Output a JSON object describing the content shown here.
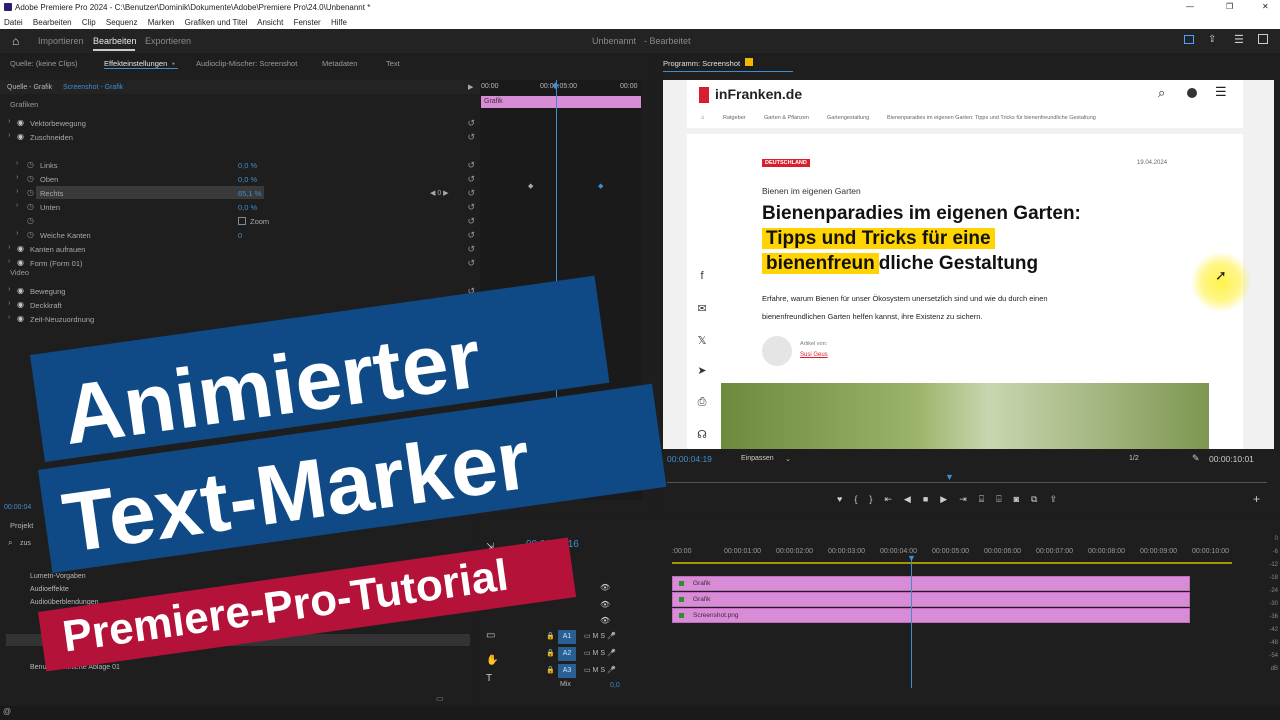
{
  "window": {
    "title": "Adobe Premiere Pro 2024 - C:\\Benutzer\\Dominik\\Dokumente\\Adobe\\Premiere Pro\\24.0\\Unbenannt *",
    "min": "—",
    "restore": "❐",
    "close": "✕"
  },
  "menu": [
    "Datei",
    "Bearbeiten",
    "Clip",
    "Sequenz",
    "Marken",
    "Grafiken und Titel",
    "Ansicht",
    "Fenster",
    "Hilfe"
  ],
  "workspace": {
    "tabs": [
      "Importieren",
      "Bearbeiten",
      "Exportieren"
    ],
    "project": "Unbenannt",
    "project_status": "- Bearbeitet"
  },
  "effects_panel": {
    "tabs": [
      "Quelle: (keine Clips)",
      "Effekteinstellungen",
      "Audioclip-Mischer: Screenshot",
      "Metadaten",
      "Text"
    ],
    "source": "Quelle - Grafik",
    "sequence": "Screenshot - Grafik",
    "sections": {
      "grafiken": "Grafiken",
      "video": "Video"
    },
    "rows": [
      {
        "label": "Vektorbewegung"
      },
      {
        "label": "Zuschneiden"
      },
      {
        "label": "Links",
        "value": "0,0 %"
      },
      {
        "label": "Oben",
        "value": "0,0 %"
      },
      {
        "label": "Rechts",
        "value": "65,1 %",
        "kf": "0"
      },
      {
        "label": "Unten",
        "value": "0,0 %"
      },
      {
        "label": "Zoom"
      },
      {
        "label": "Weiche Kanten",
        "value": "0"
      },
      {
        "label": "Kanten aufrauen"
      },
      {
        "label": "Form (Form 01)"
      },
      {
        "label": "Bewegung"
      },
      {
        "label": "Deckkraft"
      },
      {
        "label": "Zeit-Neuzuordnung"
      }
    ],
    "ruler": [
      "00:00",
      "00:00:05:00",
      "00:00"
    ],
    "clip_label": "Grafik",
    "timecode": "00:00:04"
  },
  "project_panel": {
    "tab": "Projekt",
    "search": "zus",
    "items": [
      "Lumetri-Vorgaben",
      "Audioeffekte",
      "Audioüberblendungen",
      "",
      "Benutzerdefinierte Ablage 01"
    ]
  },
  "program_monitor": {
    "tab": "Programm: Screenshot",
    "timecode": "00:00:04:19",
    "fit": "Einpassen",
    "res": "1/2",
    "duration": "00:00:10:01"
  },
  "website": {
    "logo": "inFranken.de",
    "breadcrumb": [
      "Ratgeber",
      "Garten & Pflanzen",
      "Gartengestaltung",
      "Bienenparadies im eigenen Garten: Tipps und Tricks für bienenfreundliche Gestaltung"
    ],
    "tag": "DEUTSCHLAND",
    "date": "19.04.2024",
    "kicker": "Bienen im eigenen Garten",
    "headline_1": "Bienenparadies im eigenen Garten:",
    "headline_2": "Tipps und Tricks für eine",
    "headline_3a": "bienenfreun",
    "headline_3b": "dliche Gestaltung",
    "teaser_1": "Erfahre, warum Bienen für unser Ökosystem unersetzlich sind und wie du durch einen",
    "teaser_2": "bienenfreundlichen Garten helfen kannst, ihre Existenz zu sichern.",
    "author_label": "Artikel von:",
    "author": "Susi Geus",
    "social": [
      "f",
      "✉",
      "𝕏",
      "➤",
      "⎙",
      "☊"
    ],
    "highlight": "#ffd400"
  },
  "timeline": {
    "timecode": "00:00:04:16",
    "ruler": [
      ":00:00",
      "00:00:01:00",
      "00:00:02:00",
      "00:00:03:00",
      "00:00:04:00",
      "00:00:05:00",
      "00:00:06:00",
      "00:00:07:00",
      "00:00:08:00",
      "00:00:09:00",
      "00:00:10:00"
    ],
    "clips": [
      "Grafik",
      "Grafik",
      "Screenshot.png"
    ],
    "audio_tracks": [
      "A1",
      "A2",
      "A3"
    ],
    "mix": "Mix",
    "mix_val": "0,0",
    "meter": [
      "0",
      "-6",
      "-12",
      "-18",
      "-24",
      "-30",
      "-36",
      "-42",
      "-48",
      "-54",
      "dB"
    ],
    "clip_color": "#d98cd6"
  },
  "overlay": {
    "line1": "Animierter",
    "line2": "Text-Marker",
    "line3": "Premiere-Pro-Tutorial",
    "blue": "#0f4a86",
    "red": "#b5123a"
  }
}
